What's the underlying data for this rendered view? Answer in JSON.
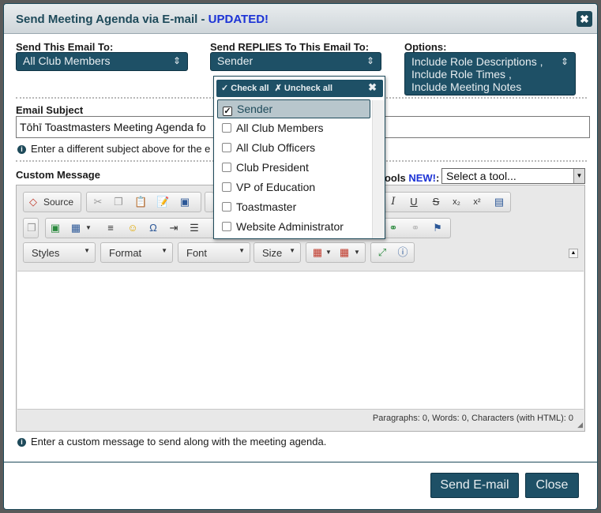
{
  "dialog": {
    "title": "Send Meeting Agenda via E-mail - ",
    "title_updated": "UPDATED!",
    "close_glyph": "✖"
  },
  "send_to": {
    "label": "Send This Email To:",
    "value": "All Club Members",
    "arrow": "⇕"
  },
  "reply_to": {
    "label": "Send REPLIES To This Email To:",
    "value": "Sender",
    "arrow": "⇕"
  },
  "options": {
    "label": "Options:",
    "values": [
      "Include Role Descriptions ,",
      "Include Role Times ,",
      "Include Meeting Notes"
    ],
    "arrow": "⇕"
  },
  "dropdown": {
    "check_all": "✓ Check all",
    "uncheck_all": "✗ Uncheck all",
    "close_glyph": "✖",
    "items": [
      {
        "label": "Sender",
        "checked": true
      },
      {
        "label": "All Club Members",
        "checked": false
      },
      {
        "label": "All Club Officers",
        "checked": false
      },
      {
        "label": "Club President",
        "checked": false
      },
      {
        "label": "VP of Education",
        "checked": false
      },
      {
        "label": "Toastmaster",
        "checked": false
      },
      {
        "label": "Website Administrator",
        "checked": false
      }
    ]
  },
  "subject": {
    "label": "Email Subject",
    "value": "Tōhī Toastmasters Meeting Agenda fo",
    "hint": "Enter a different subject above for the e"
  },
  "message": {
    "label": "Custom Message",
    "tools_label": "Tools ",
    "tools_new": "NEW!",
    "tools_colon": ":",
    "tool_select": "Select a tool...",
    "hint": "Enter a custom message to send along with the meeting agenda."
  },
  "editor": {
    "source_label": "Source",
    "combos": [
      "Styles",
      "Format",
      "Font",
      "Size"
    ],
    "status": "Paragraphs: 0, Words: 0, Characters (with HTML): 0"
  },
  "buttons": {
    "send": "Send E-mail",
    "close": "Close"
  },
  "colors": {
    "accent": "#1e5066",
    "updated": "#1c33d6"
  }
}
